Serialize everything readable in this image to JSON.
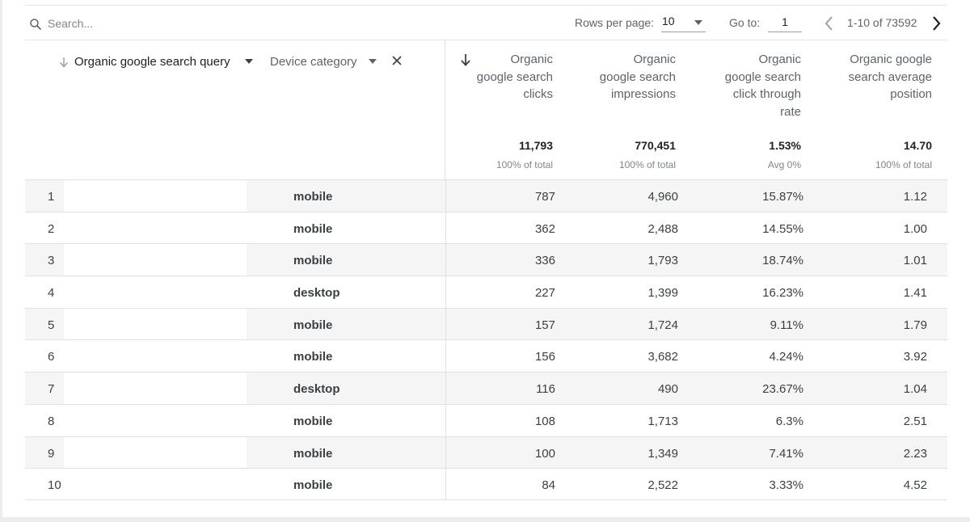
{
  "toolbar": {
    "search_placeholder": "Search...",
    "rows_per_page_label": "Rows per page:",
    "rows_per_page_value": "10",
    "goto_label": "Go to:",
    "goto_value": "1",
    "page_range": "1-10 of 73592"
  },
  "dimensions": {
    "query": "Organic google search query",
    "device": "Device category"
  },
  "metrics": [
    {
      "lines": [
        "Organic",
        "google search",
        "clicks"
      ],
      "total": "11,793",
      "sub": "100% of total"
    },
    {
      "lines": [
        "Organic",
        "google search",
        "impressions"
      ],
      "total": "770,451",
      "sub": "100% of total"
    },
    {
      "lines": [
        "Organic",
        "google search",
        "click through",
        "rate"
      ],
      "total": "1.53%",
      "sub": "Avg 0%"
    },
    {
      "lines": [
        "Organic google",
        "search average",
        "position"
      ],
      "total": "14.70",
      "sub": "100% of total"
    }
  ],
  "rows": [
    {
      "idx": "1",
      "device": "mobile",
      "clicks": "787",
      "impressions": "4,960",
      "ctr": "15.87%",
      "position": "1.12"
    },
    {
      "idx": "2",
      "device": "mobile",
      "clicks": "362",
      "impressions": "2,488",
      "ctr": "14.55%",
      "position": "1.00"
    },
    {
      "idx": "3",
      "device": "mobile",
      "clicks": "336",
      "impressions": "1,793",
      "ctr": "18.74%",
      "position": "1.01"
    },
    {
      "idx": "4",
      "device": "desktop",
      "clicks": "227",
      "impressions": "1,399",
      "ctr": "16.23%",
      "position": "1.41"
    },
    {
      "idx": "5",
      "device": "mobile",
      "clicks": "157",
      "impressions": "1,724",
      "ctr": "9.11%",
      "position": "1.79"
    },
    {
      "idx": "6",
      "device": "mobile",
      "clicks": "156",
      "impressions": "3,682",
      "ctr": "4.24%",
      "position": "3.92"
    },
    {
      "idx": "7",
      "device": "desktop",
      "clicks": "116",
      "impressions": "490",
      "ctr": "23.67%",
      "position": "1.04"
    },
    {
      "idx": "8",
      "device": "mobile",
      "clicks": "108",
      "impressions": "1,713",
      "ctr": "6.3%",
      "position": "2.51"
    },
    {
      "idx": "9",
      "device": "mobile",
      "clicks": "100",
      "impressions": "1,349",
      "ctr": "7.41%",
      "position": "2.23"
    },
    {
      "idx": "10",
      "device": "mobile",
      "clicks": "84",
      "impressions": "2,522",
      "ctr": "3.33%",
      "position": "4.52"
    }
  ],
  "icons": {
    "search": "search-icon",
    "caret": "caret-down-icon",
    "sort": "arrow-down-icon",
    "close": "close-icon",
    "prev": "chevron-left-icon",
    "next": "chevron-right-icon"
  },
  "colors": {
    "row_shade": "#f5f5f5",
    "text": "#3c4043",
    "muted": "#80868b"
  }
}
